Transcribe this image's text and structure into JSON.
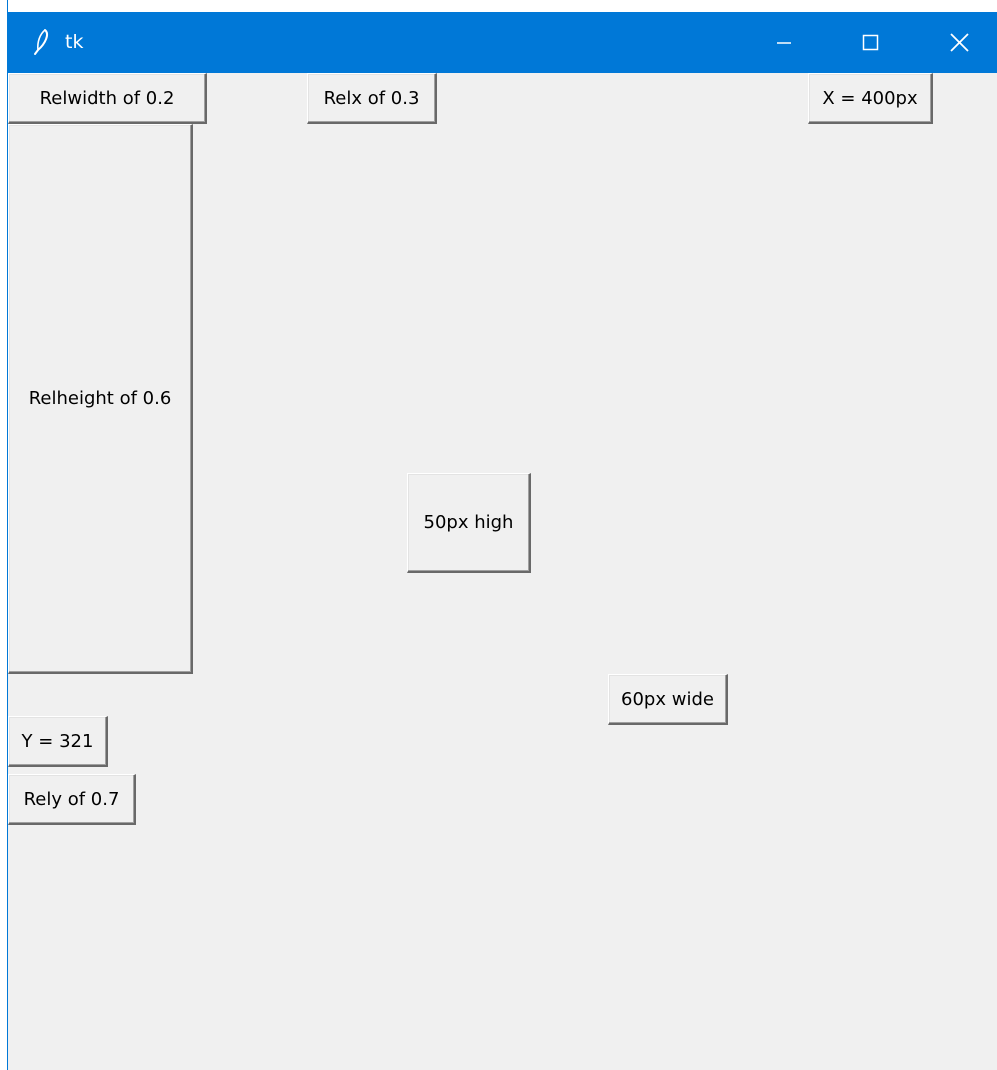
{
  "window": {
    "title": "tk",
    "icon": "feather-icon",
    "controls": {
      "minimize": "minimize-icon",
      "maximize": "maximize-icon",
      "close": "close-icon"
    },
    "accent_color": "#0078d7",
    "background_color": "#f0f0f0"
  },
  "buttons": {
    "relwidth": "Relwidth of 0.2",
    "relx": "Relx of 0.3",
    "x_400": "X = 400px",
    "relheight": "Relheight of 0.6",
    "height_50": "50px high",
    "width_60": "60px wide",
    "y_321": "Y = 321",
    "rely": "Rely of 0.7"
  }
}
